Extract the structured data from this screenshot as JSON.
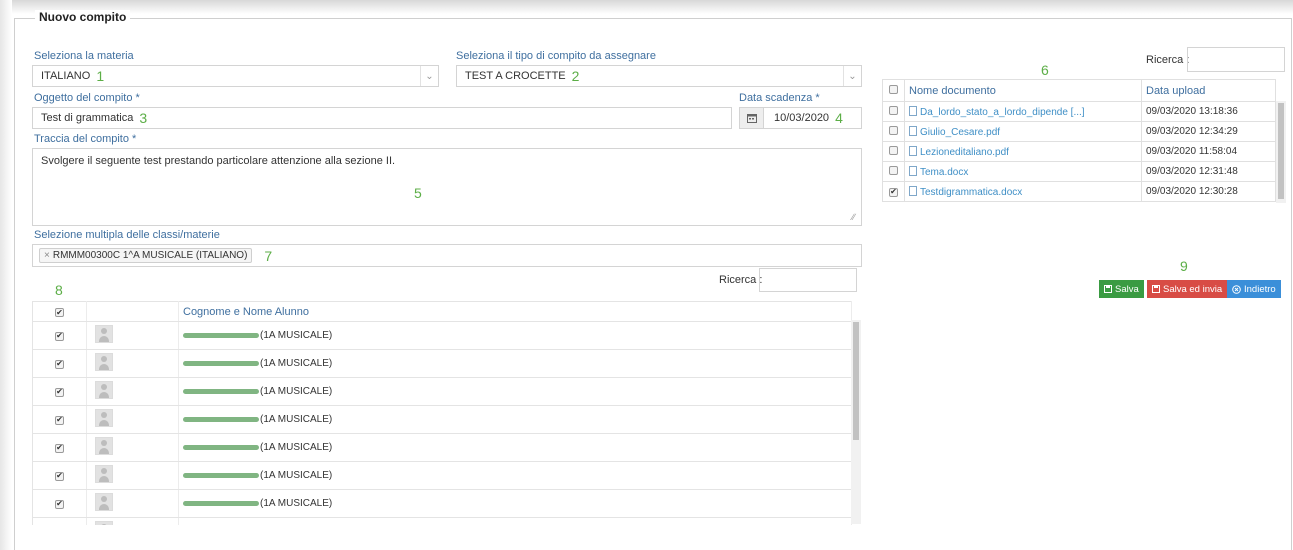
{
  "panel": {
    "legend": "Nuovo compito"
  },
  "materia": {
    "label": "Seleziona la materia",
    "value": "ITALIANO",
    "marker": "1"
  },
  "tipo": {
    "label": "Seleziona il tipo di compito da assegnare",
    "value": "TEST A CROCETTE",
    "marker": "2"
  },
  "oggetto": {
    "label": "Oggetto del compito *",
    "value": "Test di grammatica",
    "marker": "3"
  },
  "scadenza": {
    "label": "Data scadenza *",
    "value": "10/03/2020",
    "marker": "4",
    "icon": "calendar-icon"
  },
  "traccia": {
    "label": "Traccia del compito *",
    "value": "Svolgere il seguente test prestando particolare attenzione alla sezione II.",
    "marker": "5"
  },
  "classi": {
    "label": "Selezione multipla delle classi/materie",
    "tag": "RMMM00300C 1^A MUSICALE (ITALIANO)",
    "tag_remove": "×",
    "marker": "7"
  },
  "documents": {
    "search_label": "Ricerca :",
    "marker": "6",
    "headers": [
      "Nome documento",
      "Data upload"
    ],
    "rows": [
      {
        "name": "Da_lordo_stato_a_lordo_dipende [...]",
        "date": "09/03/2020 13:18:36",
        "checked": false
      },
      {
        "name": "Giulio_Cesare.pdf",
        "date": "09/03/2020 12:34:29",
        "checked": false
      },
      {
        "name": "Lezioneditaliano.pdf",
        "date": "09/03/2020 11:58:04",
        "checked": false
      },
      {
        "name": "Tema.docx",
        "date": "09/03/2020 12:31:48",
        "checked": false
      },
      {
        "name": "Testdigrammatica.docx",
        "date": "09/03/2020 12:30:28",
        "checked": true
      }
    ]
  },
  "students": {
    "search_label": "Ricerca :",
    "marker": "8",
    "header": "Cognome e Nome Alunno",
    "rows": [
      {
        "class": "(1A MUSICALE)",
        "checked": true
      },
      {
        "class": "(1A MUSICALE)",
        "checked": true
      },
      {
        "class": "(1A MUSICALE)",
        "checked": true
      },
      {
        "class": "(1A MUSICALE)",
        "checked": true
      },
      {
        "class": "(1A MUSICALE)",
        "checked": true
      },
      {
        "class": "(1A MUSICALE)",
        "checked": true
      },
      {
        "class": "(1A MUSICALE)",
        "checked": true
      }
    ]
  },
  "actions": {
    "marker": "9",
    "save": "Salva",
    "save_send": "Salva ed invia",
    "back": "Indietro",
    "colors": {
      "save": "#3a9b42",
      "save_send": "#d84c45",
      "back": "#3b8fd9"
    }
  }
}
